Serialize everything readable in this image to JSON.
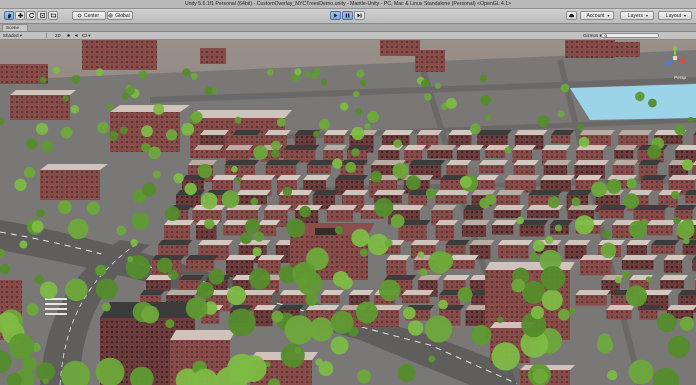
{
  "window": {
    "title": "Unity 5.6.1f1 Personal (64bit) - CustomOverlay_NYCTreesDemo.unity - Mantle-Unity - PC, Mac & Linux Standalone (Personal) <OpenGL 4.1>"
  },
  "toolbar": {
    "tools": [
      {
        "name": "hand-tool-button",
        "icon": "hand-icon",
        "active": true
      },
      {
        "name": "move-tool-button",
        "icon": "move-icon",
        "active": false
      },
      {
        "name": "rotate-tool-button",
        "icon": "rotate-icon",
        "active": false
      },
      {
        "name": "scale-tool-button",
        "icon": "scale-icon",
        "active": false
      },
      {
        "name": "rect-tool-button",
        "icon": "rect-icon",
        "active": false
      }
    ],
    "pivot_label": "Center",
    "space_label": "Global",
    "play_icon": "play-icon",
    "pause_icon": "pause-icon",
    "step_icon": "step-icon",
    "collab_icon": "cloud-icon",
    "account_label": "Account",
    "layers_label": "Layers",
    "layout_label": "Layout"
  },
  "scene_tab": {
    "label": "Scene"
  },
  "scene_bar": {
    "shading_mode": "Shaded",
    "view_mode": "2D",
    "gizmos_label": "Gizmos",
    "search_placeholder": "",
    "persp_label": "Persp"
  },
  "colors": {
    "titlebar": "#b9b9b9",
    "toolbar": "#c6c6c6",
    "active_tool": "#8eb6ea",
    "road": "#6f6e6d",
    "building_brick": "#8a4f4d",
    "roof": "#cfc3bb",
    "tree": "#6ea83b",
    "water": "#9bd3e8"
  }
}
